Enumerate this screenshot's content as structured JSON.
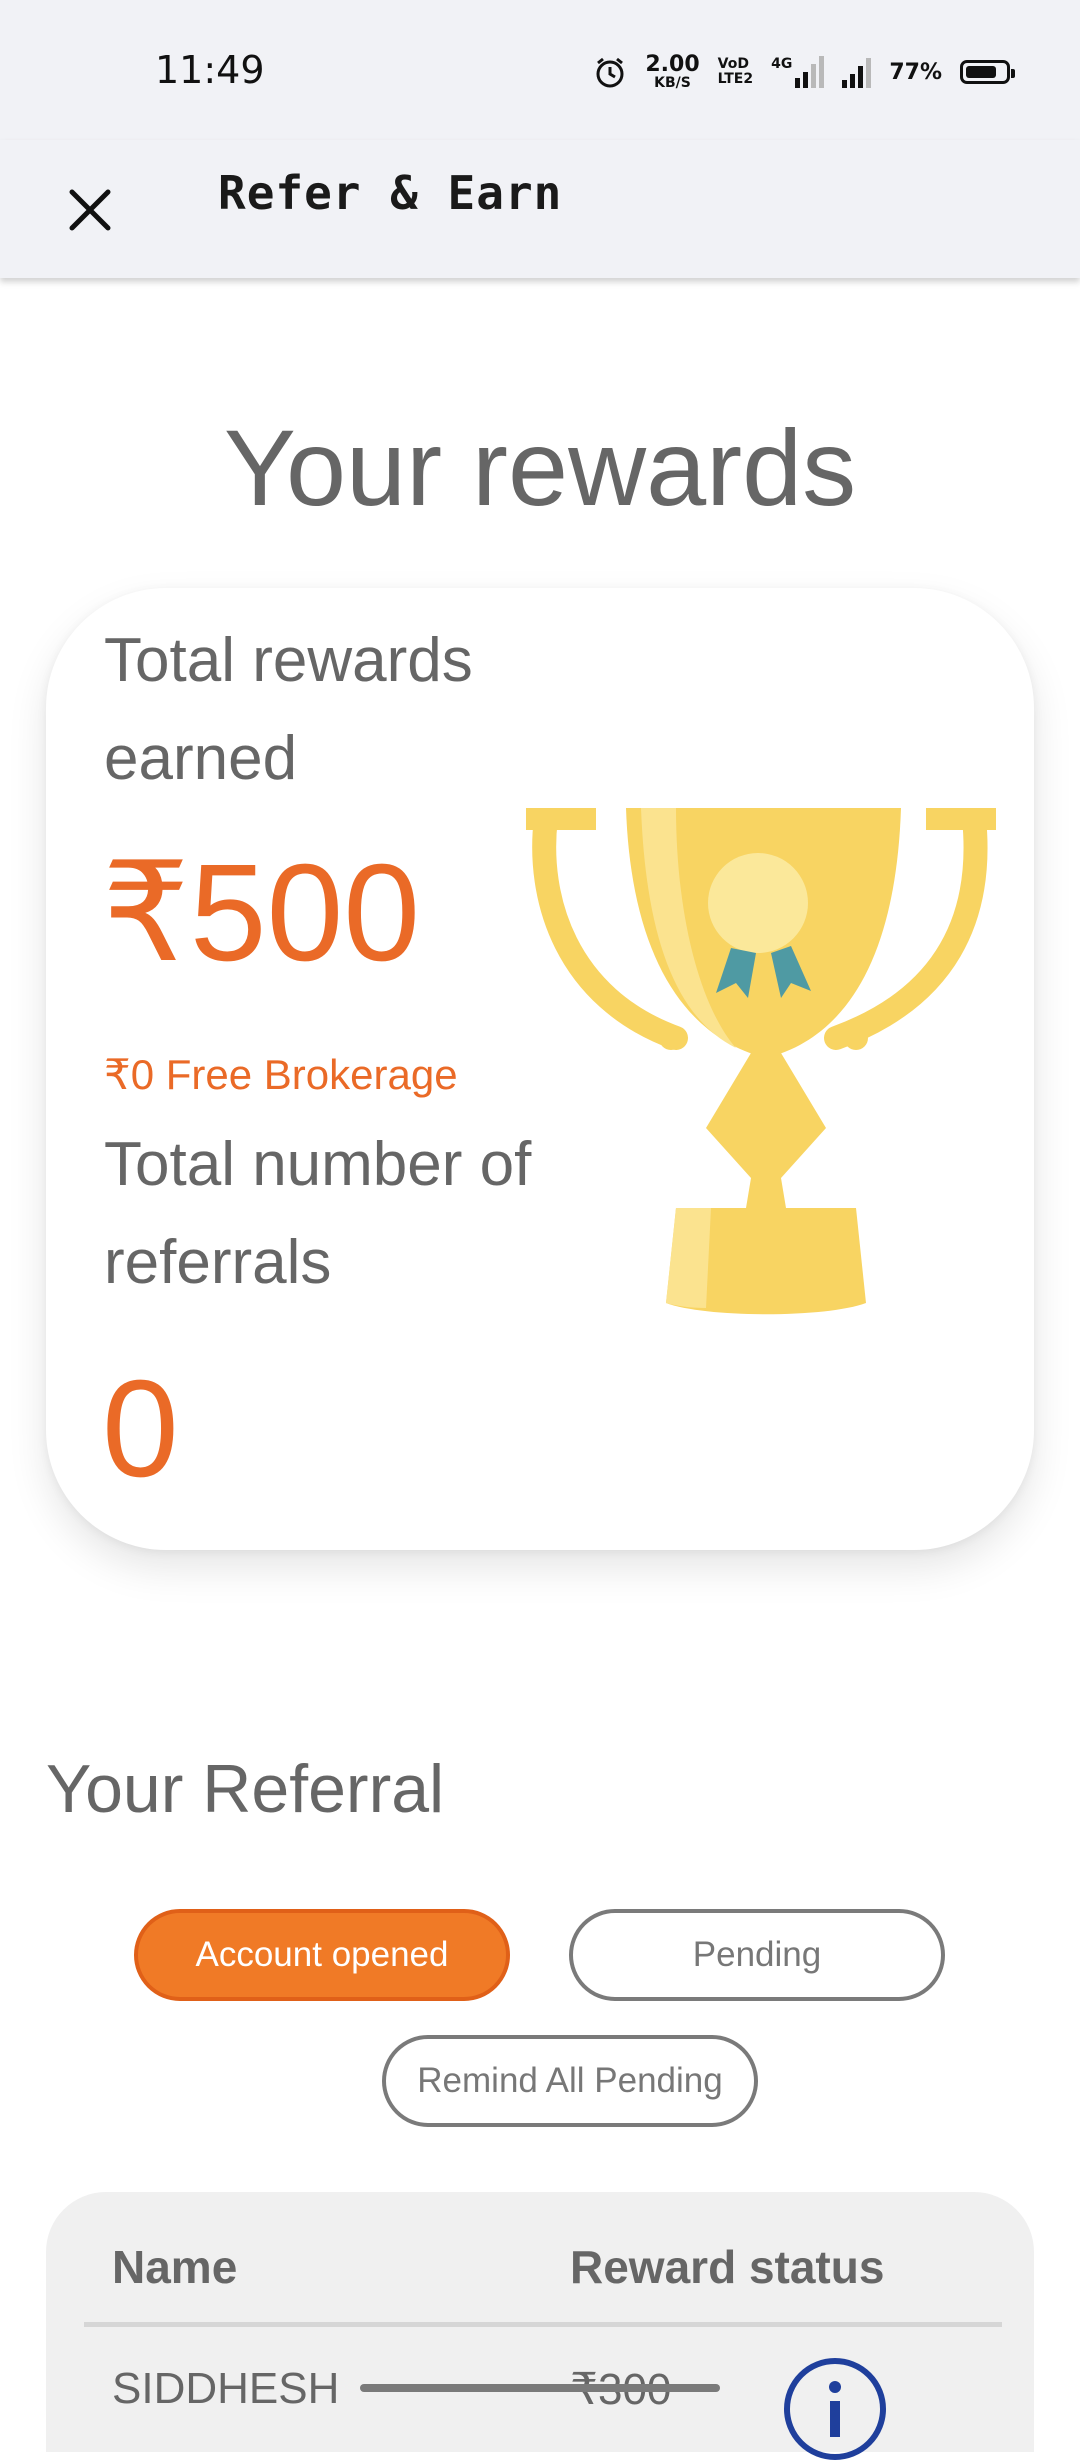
{
  "status_bar": {
    "time": "11:49",
    "net_speed_value": "2.00",
    "net_speed_unit": "KB/S",
    "volte_line1": "VoD",
    "volte_line2": "LTE2",
    "network_type": "4G",
    "battery_percent": "77%",
    "battery_level": 0.77,
    "icons": [
      "alarm-icon",
      "signal-icon",
      "battery-icon"
    ]
  },
  "app_bar": {
    "title": "Refer & Earn",
    "close_icon": "close-icon"
  },
  "page_heading": "Your rewards",
  "rewards_card": {
    "total_rewards_label_line1": "Total rewards",
    "total_rewards_label_line2": "earned",
    "total_rewards_value": "₹500",
    "free_brokerage": "₹0 Free Brokerage",
    "referrals_label_line1": "Total number of",
    "referrals_label_line2": "referrals",
    "referrals_value": "0",
    "illustration": "trophy-icon"
  },
  "referral_section": {
    "title": "Your Referral",
    "tabs": [
      {
        "label": "Account opened",
        "active": true
      },
      {
        "label": "Pending",
        "active": false
      }
    ],
    "remind_button": "Remind All Pending",
    "table": {
      "headers": [
        "Name",
        "Reward status"
      ],
      "rows": [
        {
          "name": "SIDDHESH",
          "reward": "₹300",
          "icon": "info-icon"
        }
      ]
    }
  },
  "colors": {
    "accent": "#ea6a27",
    "accent_button": "#f07a26",
    "text_grey": "#666666",
    "bar_bg": "#f1f2f6",
    "trophy": "#f8d462"
  }
}
